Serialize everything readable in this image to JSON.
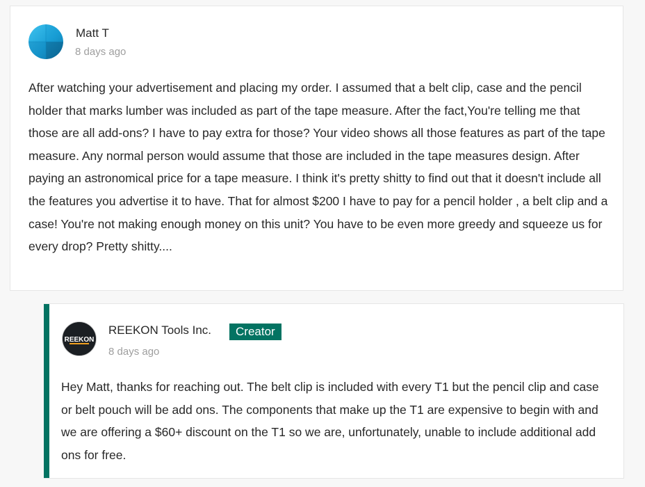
{
  "comment": {
    "author": "Matt T",
    "timestamp": "8 days ago",
    "body": "After watching your advertisement and placing my order. I assumed that a belt clip, case and the pencil holder that marks lumber was included as part of the tape measure. After the fact,You're telling me that those are all add-ons? I have to pay extra for those? Your video shows all those features as part of the tape measure. Any normal person would assume that those are included in the tape measures design. After paying an astronomical price for a tape measure. I think it's pretty shitty to find out that it doesn't include all the features you advertise it to have. That for almost $200 I have to pay for a pencil holder , a belt clip and a case! You're not making enough money on this unit? You have to be even more greedy and squeeze us for every drop? Pretty shitty....",
    "avatar_icon": "blue-gradient-avatar",
    "avatar_color": "#1aa3d9"
  },
  "reply": {
    "author": "REEKON Tools Inc.",
    "badge": "Creator",
    "timestamp": "8 days ago",
    "body": "Hey Matt, thanks for reaching out. The belt clip is included with every T1 but the pencil clip and case or belt pouch will be add ons. The components that make up the T1 are expensive to begin with and we are offering a $60+ discount on the T1 so we are, unfortunately, unable to include additional add ons for free.",
    "logo_text": "REEKON",
    "avatar_icon": "reekon-logo-avatar",
    "accent_color": "#037362"
  }
}
